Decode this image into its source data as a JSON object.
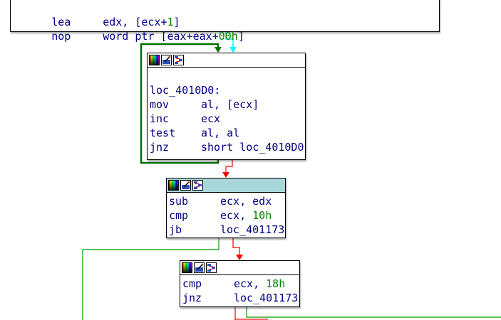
{
  "colors": {
    "edge_true": "#00a000",
    "edge_false": "#ff0000",
    "edge_normal": "#00ffff",
    "loop_back": "#007000",
    "node_selected_title": "#a8d6d9",
    "text": "#000080",
    "number": "#008000"
  },
  "icons": [
    "color-picker-icon",
    "rename-icon",
    "graph-overview-icon"
  ],
  "block_top": {
    "lines": [
      {
        "mnem": "lea",
        "op_pre": "edx, [ecx+",
        "op_num": "1",
        "op_post": "]"
      },
      {
        "mnem": "nop",
        "op_pre": "word ptr [eax+eax+",
        "op_num": "00h",
        "op_post": "]"
      }
    ]
  },
  "block_loop": {
    "label": "loc_4010D0:",
    "lines": [
      {
        "mnem": "mov",
        "op_pre": "al, [ecx]",
        "op_num": "",
        "op_post": ""
      },
      {
        "mnem": "inc",
        "op_pre": "ecx",
        "op_num": "",
        "op_post": ""
      },
      {
        "mnem": "test",
        "op_pre": "al, al",
        "op_num": "",
        "op_post": ""
      },
      {
        "mnem": "jnz",
        "op_pre": "short loc_4010D0",
        "op_num": "",
        "op_post": ""
      }
    ]
  },
  "block_sub": {
    "lines": [
      {
        "mnem": "sub",
        "op_pre": "ecx, edx",
        "op_num": "",
        "op_post": ""
      },
      {
        "mnem": "cmp",
        "op_pre": "ecx, ",
        "op_num": "10h",
        "op_post": ""
      },
      {
        "mnem": "jb",
        "op_pre": "loc_401173",
        "op_num": "",
        "op_post": ""
      }
    ]
  },
  "block_cmp": {
    "lines": [
      {
        "mnem": "cmp",
        "op_pre": "ecx, ",
        "op_num": "18h",
        "op_post": ""
      },
      {
        "mnem": "jnz",
        "op_pre": "loc_401173",
        "op_num": "",
        "op_post": ""
      }
    ]
  }
}
